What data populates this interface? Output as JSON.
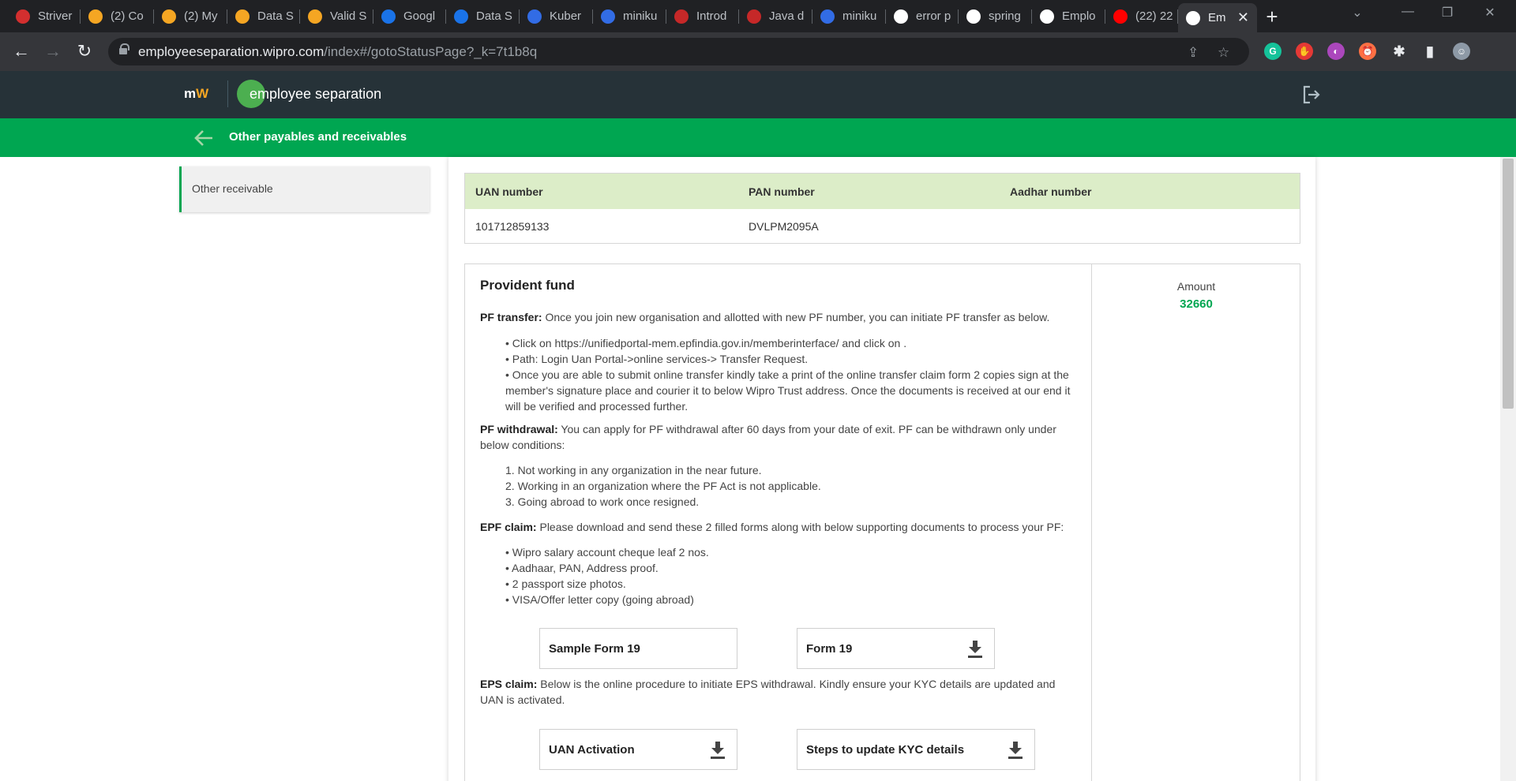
{
  "browser": {
    "tabs": [
      {
        "label": "Striver",
        "icon": "tuf-icon",
        "color": "#d32f2f"
      },
      {
        "label": "(2) Co",
        "icon": "leetcode-icon",
        "color": "#f5a623"
      },
      {
        "label": "(2) My",
        "icon": "leetcode-icon",
        "color": "#f5a623"
      },
      {
        "label": "Data S",
        "icon": "leetcode-icon",
        "color": "#f5a623"
      },
      {
        "label": "Valid S",
        "icon": "leetcode-icon",
        "color": "#f5a623"
      },
      {
        "label": "Googl",
        "icon": "at-icon",
        "color": "#1a73e8"
      },
      {
        "label": "Data S",
        "icon": "at-icon",
        "color": "#1a73e8"
      },
      {
        "label": "Kuber",
        "icon": "kubernetes-icon",
        "color": "#326ce5"
      },
      {
        "label": "miniku",
        "icon": "minikube-icon",
        "color": "#326ce5"
      },
      {
        "label": "Introd",
        "icon": "docs-icon",
        "color": "#c62828"
      },
      {
        "label": "Java d",
        "icon": "docs-icon",
        "color": "#c62828"
      },
      {
        "label": "miniku",
        "icon": "minikube-icon",
        "color": "#326ce5"
      },
      {
        "label": "error p",
        "icon": "github-icon",
        "color": "#ffffff"
      },
      {
        "label": "spring",
        "icon": "github-icon",
        "color": "#ffffff"
      },
      {
        "label": "Emplo",
        "icon": "wipro-icon",
        "color": "#ffffff"
      },
      {
        "label": "(22) 22",
        "icon": "youtube-icon",
        "color": "#ff0000"
      },
      {
        "label": "Em",
        "icon": "wipro-icon",
        "color": "#ffffff"
      }
    ],
    "url_host": "employeeseparation.wipro.com",
    "url_path": "/index#/gotoStatusPage?_k=7t1b8q"
  },
  "header": {
    "logo_m": "m",
    "logo_w": "W",
    "app_title": "employee separation"
  },
  "subheader": {
    "title": "Other payables and receivables"
  },
  "sidebar": {
    "items": [
      {
        "label": "Other receivable"
      }
    ]
  },
  "info_table": {
    "headers": [
      "UAN number",
      "PAN number",
      "Aadhar number"
    ],
    "values": [
      "101712859133",
      "DVLPM2095A",
      ""
    ]
  },
  "provident_fund": {
    "title": "Provident fund",
    "amount_label": "Amount",
    "amount_value": "32660",
    "pf_transfer": {
      "label": "PF transfer:",
      "text": " Once you join new organisation and allotted with new PF number, you can initiate PF transfer as below.",
      "items": [
        "• Click on https://unifiedportal-mem.epfindia.gov.in/memberinterface/ and click on .",
        "• Path: Login Uan Portal->online services-> Transfer Request.",
        "• Once you are able to submit online transfer kindly take a print of the online transfer claim form 2 copies sign at the member's signature place and courier it to below Wipro Trust address. Once the documents is received at our end it will be verified and processed further."
      ]
    },
    "pf_withdrawal": {
      "label": "PF withdrawal:",
      "text": " You can apply for PF withdrawal after 60 days from your date of exit. PF can be withdrawn only under below conditions:",
      "items": [
        "1. Not working in any organization in the near future.",
        "2. Working in an organization where the PF Act is not applicable.",
        "3. Going abroad to work once resigned."
      ]
    },
    "epf_claim": {
      "label": "EPF claim:",
      "text": " Please download and send these 2 filled forms along with below supporting documents to process your PF:",
      "items": [
        "• Wipro salary account cheque leaf 2 nos.",
        "• Aadhaar, PAN, Address proof.",
        "• 2 passport size photos.",
        "• VISA/Offer letter copy (going abroad)"
      ],
      "buttons": [
        "Sample Form 19",
        "Form 19"
      ]
    },
    "eps_claim": {
      "label": "EPS claim:",
      "text": " Below is the online procedure to initiate EPS withdrawal. Kindly ensure your KYC details are updated and UAN is activated.",
      "buttons": [
        "UAN Activation",
        "Steps to update KYC details"
      ]
    }
  }
}
